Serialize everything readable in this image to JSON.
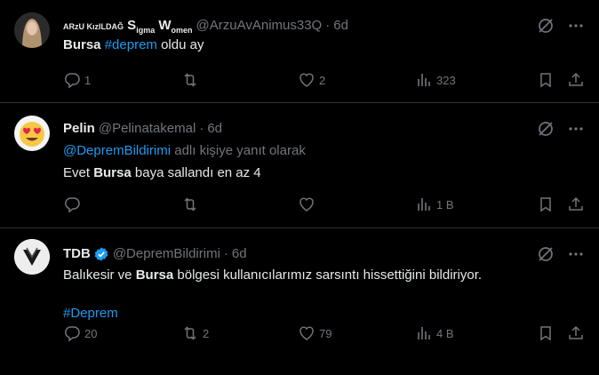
{
  "tweets": [
    {
      "display_name_parts": [
        "ARzU KızILDAĞ",
        " S",
        "ig",
        "ma",
        " W",
        "omen"
      ],
      "handle": "@ArzuAvAnimus33Q",
      "time": "6d",
      "text_bold": "Bursa",
      "text_link": "#deprem",
      "text_rest": " oldu ay",
      "replies": "1",
      "retweets": "",
      "likes": "2",
      "views": "323"
    },
    {
      "display_name": "Pelin",
      "handle": "@Pelinatakemal",
      "time": "6d",
      "reply_to_link": "@DepremBildirimi",
      "reply_to_suffix": " adlı kişiye yanıt olarak",
      "text_pre": "Evet ",
      "text_bold": "Bursa",
      "text_rest": " baya sallandı en az 4",
      "replies": "",
      "retweets": "",
      "likes": "",
      "views": "1 B"
    },
    {
      "display_name": "TDB",
      "handle": "@DepremBildirimi",
      "time": "6d",
      "verified": true,
      "text_pre": "Balıkesir ve ",
      "text_bold": "Bursa",
      "text_rest": " bölgesi kullanıcılarımız sarsıntı hissettiğini bildiriyor.",
      "hashtag": "#Deprem",
      "replies": "20",
      "retweets": "2",
      "likes": "79",
      "views": "4 B"
    }
  ],
  "dot": "·",
  "colors": {
    "background": "#000000",
    "text": "#e7e9ea",
    "muted": "#71767b",
    "link": "#1d9bf0",
    "border": "#2f3336"
  }
}
